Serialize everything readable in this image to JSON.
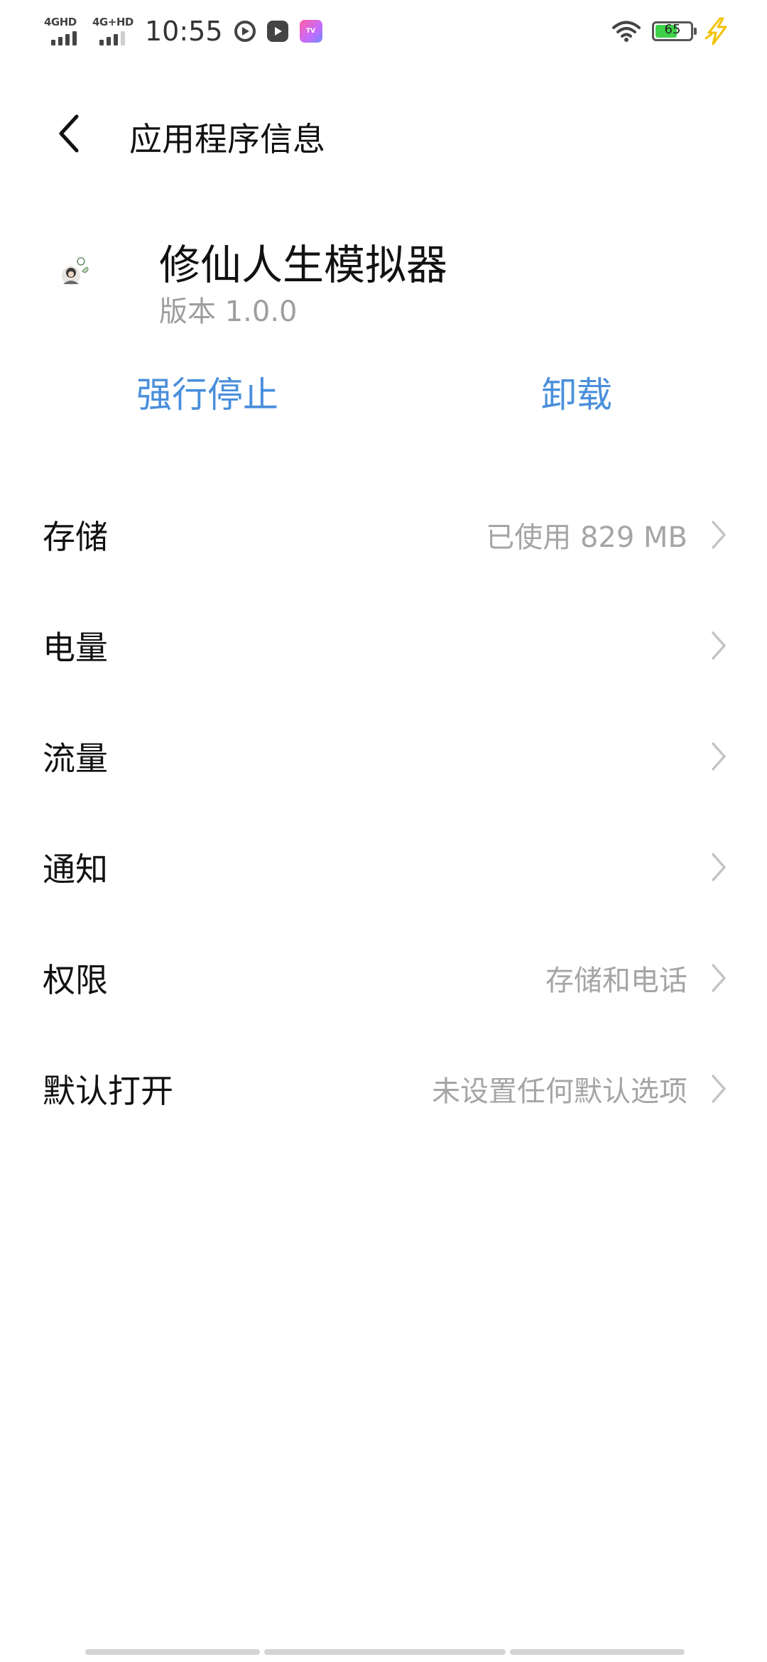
{
  "status_bar": {
    "sim1_label": "4GHD",
    "sim2_label": "4G+HD",
    "time": "10:55",
    "battery_level": 65,
    "battery_text": "65",
    "battery_color": "#3fd14a",
    "icons": [
      "signal-icon",
      "play-icon",
      "video-icon",
      "tv-app-icon",
      "wifi-icon",
      "battery-icon",
      "charging-icon"
    ]
  },
  "header": {
    "title": "应用程序信息",
    "back_icon": "chevron-left-icon"
  },
  "app": {
    "name": "修仙人生模拟器",
    "version": "版本 1.0.0"
  },
  "actions": {
    "force_stop": "强行停止",
    "uninstall": "卸载",
    "accent_color": "#4a8fdc"
  },
  "settings": [
    {
      "label": "存储",
      "value": "已使用 829 MB"
    },
    {
      "label": "电量",
      "value": ""
    },
    {
      "label": "流量",
      "value": ""
    },
    {
      "label": "通知",
      "value": ""
    },
    {
      "label": "权限",
      "value": "存储和电话"
    },
    {
      "label": "默认打开",
      "value": "未设置任何默认选项"
    }
  ]
}
